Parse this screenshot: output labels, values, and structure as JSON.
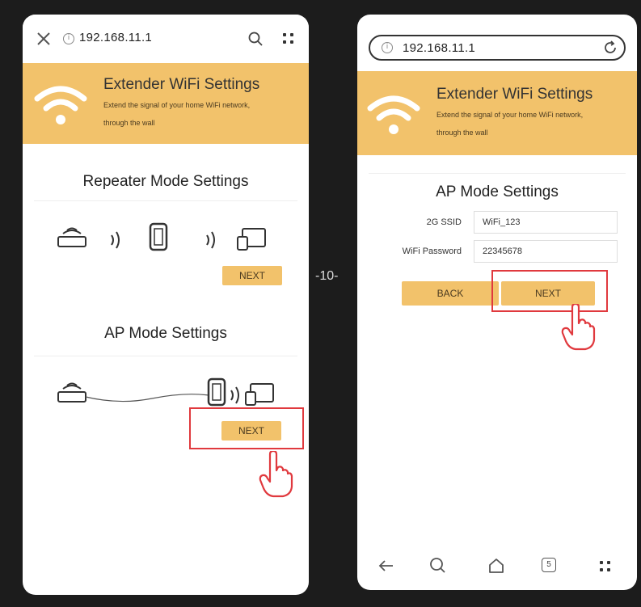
{
  "left_phone": {
    "url": "192.168.11.1",
    "banner": {
      "title": "Extender WiFi Settings",
      "subtitle_line1": "Extend the signal of your home WiFi network,",
      "subtitle_line2": "through the wall"
    },
    "repeater": {
      "title": "Repeater Mode Settings",
      "next_label": "NEXT"
    },
    "ap": {
      "title": "AP Mode Settings",
      "next_label": "NEXT"
    }
  },
  "page_number": "-10-",
  "right_phone": {
    "url": "192.168.11.1",
    "banner": {
      "title": "Extender WiFi Settings",
      "subtitle_line1": "Extend the signal of your home WiFi network,",
      "subtitle_line2": "through the wall"
    },
    "ap_form": {
      "title": "AP Mode Settings",
      "ssid_label": "2G SSID",
      "ssid_value": "WiFi_123",
      "password_label": "WiFi Password",
      "password_value": "22345678",
      "back_label": "BACK",
      "next_label": "NEXT"
    },
    "bottom_nav": {
      "tab_count": "5"
    }
  },
  "colors": {
    "accent": "#f2c26b",
    "highlight": "#e0393e",
    "background": "#1c1c1c"
  }
}
